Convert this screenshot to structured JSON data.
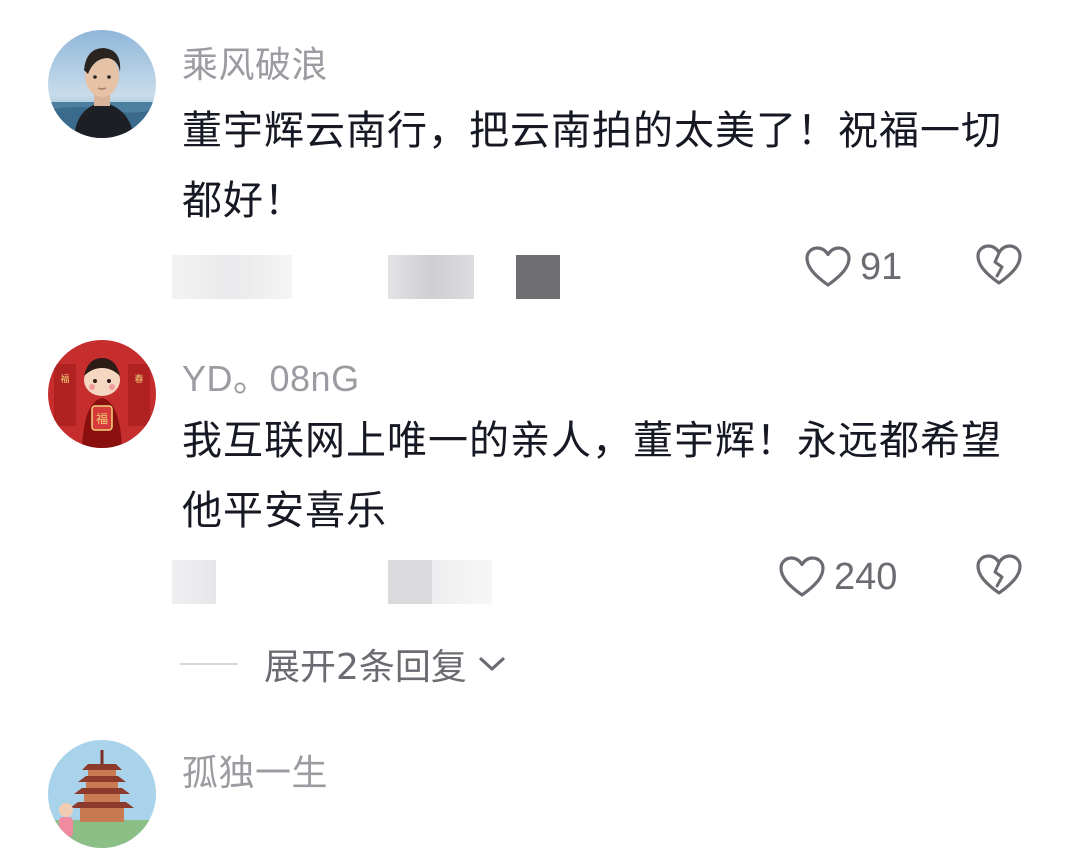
{
  "comments": [
    {
      "username": "乘风破浪",
      "content": "董宇辉云南行，把云南拍的太美了！祝福一切都好！",
      "likes": "91",
      "avatar_icon": "man-portrait-seaside-avatar"
    },
    {
      "username": "YD。08nG",
      "content": "我互联网上唯一的亲人，董宇辉！永远都希望他平安喜乐",
      "likes": "240",
      "avatar_icon": "chinese-new-year-boy-avatar"
    },
    {
      "username": "孤独一生",
      "avatar_icon": "pagoda-avatar"
    }
  ],
  "reply_expand": {
    "label": "展开2条回复"
  },
  "icons": {
    "like": "heart-outline-icon",
    "dislike": "broken-heart-icon",
    "expand": "chevron-down-icon"
  },
  "colors": {
    "username": "#9b9ca1",
    "content": "#161823",
    "count": "#6b6c72"
  }
}
